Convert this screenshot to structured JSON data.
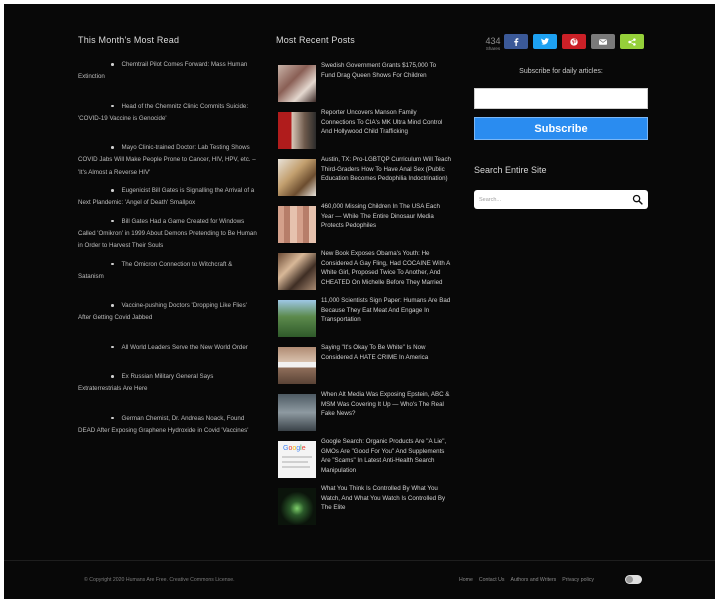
{
  "most_read": {
    "title": "This Month's Most Read",
    "items": [
      "Chemtrail Pilot Comes Forward: Mass Human Extinction",
      "Head of the Chemnitz Clinic Commits Suicide: 'COVID-19 Vaccine is Genocide'",
      "Mayo Clinic-trained Doctor: Lab Testing Shows COVID Jabs Will Make People Prone to Cancer, HIV, HPV, etc. – 'It's Almost a Reverse HIV'",
      "Eugenicist Bill Gates is Signalling the Arrival of a Next Plandemic: 'Angel of Death' Smallpox",
      "Bill Gates Had a Game Created for Windows Called 'Omikron' in 1999 About Demons Pretending to Be Human in Order to Harvest Their Souls",
      "The Omicron Connection to Witchcraft & Satanism",
      "Vaccine-pushing Doctors 'Dropping Like Flies' After Getting Covid Jabbed",
      "All World Leaders Serve the New World Order",
      "Ex Russian Military General Says Extraterrestrials Are Here",
      "German Chemist, Dr. Andreas Noack, Found DEAD After Exposing Graphene Hydroxide in Covid 'Vaccines'"
    ]
  },
  "recent_posts": {
    "title": "Most Recent Posts",
    "items": [
      "Swedish Government Grants $175,000 To Fund Drag Queen Shows For Children",
      "Reporter Uncovers Manson Family Connections To CIA's MK Ultra Mind Control And Hollywood Child Trafficking",
      "Austin, TX: Pro-LGBTQP Curriculum Will Teach Third-Graders How To Have Anal Sex (Public Education Becomes Pedophilia Indoctrination)",
      "460,000 Missing Children In The USA Each Year — While The Entire Dinosaur Media Protects Pedophiles",
      "New Book Exposes Obama's Youth: He Considered A Gay Fling, Had COCAINE With A White Girl, Proposed Twice To Another, And CHEATED On Michelle Before They Married",
      "11,000 Scientists Sign Paper: Humans Are Bad Because They Eat Meat And Engage In Transportation",
      "Saying \"It's Okay To Be White\" Is Now Considered A HATE CRIME In America",
      "When Alt Media Was Exposing Epstein, ABC & MSM Was Covering It Up — Who's The Real Fake News?",
      "Google Search: Organic Products Are \"A Lie\", GMOs Are \"Good For You\" And Supplements Are \"Scams\" In Latest Anti-Health Search Manipulation",
      "What You Think Is Controlled By What You Watch, And What You Watch Is Controlled By The Elite"
    ]
  },
  "share": {
    "count": "434",
    "count_label": "Shares",
    "buttons": [
      {
        "name": "facebook-icon",
        "color": "#3b5998"
      },
      {
        "name": "twitter-icon",
        "color": "#1da1f2"
      },
      {
        "name": "pinterest-icon",
        "color": "#cb2027"
      },
      {
        "name": "email-icon",
        "color": "#7a7a7a"
      },
      {
        "name": "sharethis-icon",
        "color": "#95d03a"
      }
    ]
  },
  "subscribe": {
    "label": "Subscribe for daily articles:",
    "email_value": "",
    "button": "Subscribe"
  },
  "search": {
    "title": "Search Entire Site",
    "placeholder": "Search..."
  },
  "footer": {
    "copyright": "© Copyright 2020 Humans Are Free. Creative Commons License.",
    "links": [
      "Home",
      "Contact Us",
      "Authors and Writers",
      "Privacy policy"
    ]
  }
}
